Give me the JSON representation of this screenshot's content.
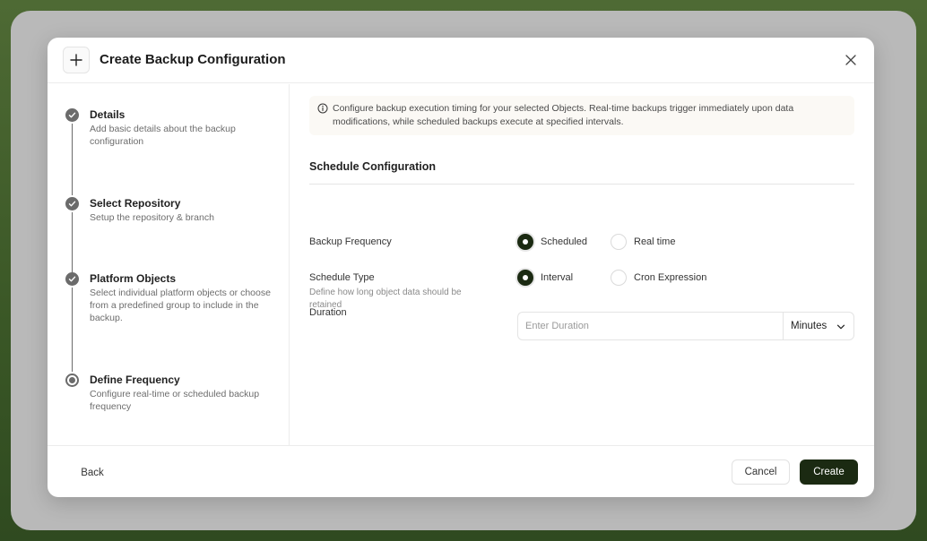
{
  "modal": {
    "title": "Create Backup Configuration"
  },
  "steps": [
    {
      "title": "Details",
      "desc": "Add basic details about the backup configuration",
      "state": "complete"
    },
    {
      "title": "Select Repository",
      "desc": "Setup the repository & branch",
      "state": "complete"
    },
    {
      "title": "Platform Objects",
      "desc": "Select individual platform objects or choose from a predefined group to include in the backup.",
      "state": "complete"
    },
    {
      "title": "Define Frequency",
      "desc": "Configure real-time or scheduled backup frequency",
      "state": "active"
    }
  ],
  "info": {
    "text": "Configure backup execution timing for your selected Objects. Real-time backups trigger immediately upon data modifications, while scheduled backups execute at specified intervals."
  },
  "schedule": {
    "section_title": "Schedule Configuration",
    "backup_frequency": {
      "label": "Backup Frequency",
      "options": [
        "Scheduled",
        "Real time"
      ],
      "selected": "Scheduled"
    },
    "schedule_type": {
      "label": "Schedule Type",
      "options": [
        "Interval",
        "Cron Expression"
      ],
      "selected": "Interval"
    },
    "duration": {
      "label": "Duration",
      "sublabel": "Define how long object data should be retained",
      "value": "",
      "placeholder": "Enter Duration",
      "unit": "Minutes"
    }
  },
  "footer": {
    "back_label": "Back",
    "cancel_label": "Cancel",
    "create_label": "Create"
  },
  "colors": {
    "primary": "#1b2a12",
    "step": "#6b6b6b",
    "info_bg": "#fbf9f5"
  }
}
